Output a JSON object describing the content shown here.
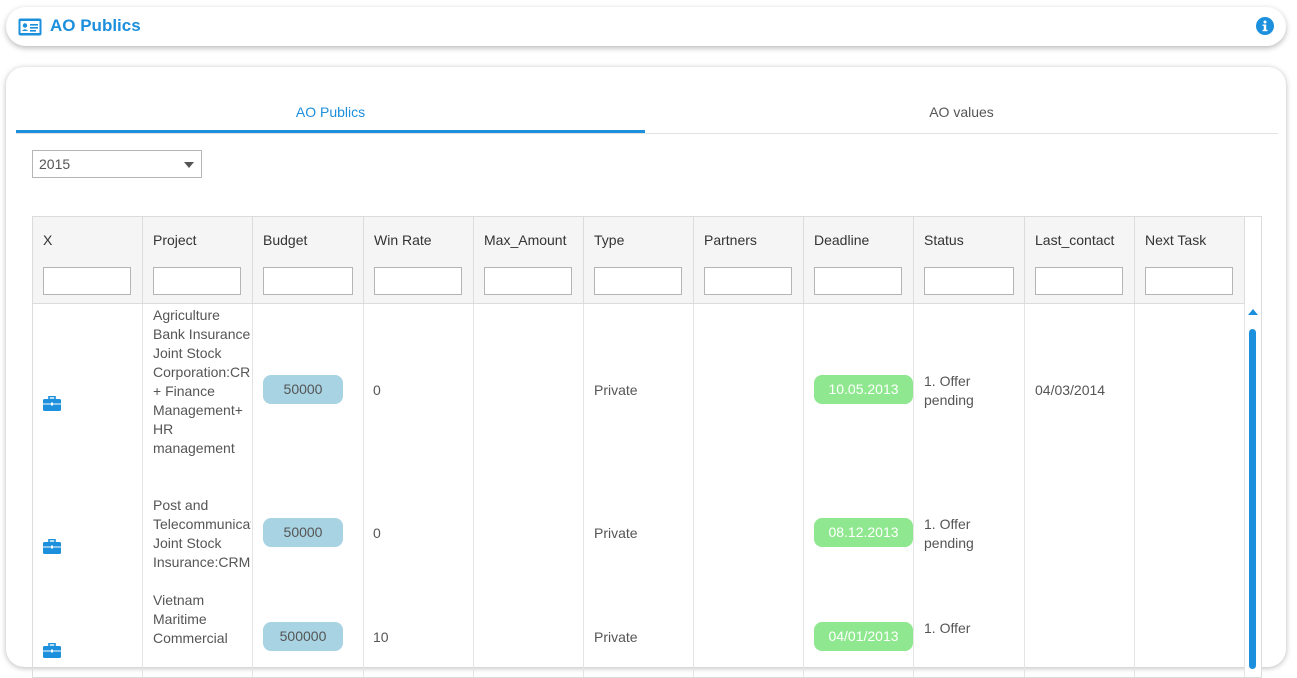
{
  "header": {
    "title": "AO Publics",
    "icon": "id-card-icon",
    "info_icon": "info-icon"
  },
  "tabs": [
    {
      "label": "AO Publics",
      "active": true
    },
    {
      "label": "AO values",
      "active": false
    }
  ],
  "year_select": {
    "value": "2015"
  },
  "table": {
    "columns": [
      "X",
      "Project",
      "Budget",
      "Win Rate",
      "Max_Amount",
      "Type",
      "Partners",
      "Deadline",
      "Status",
      "Last_contact",
      "Next Task"
    ],
    "rows": [
      {
        "icon": "briefcase-icon",
        "project": "Agriculture Bank Insurance Joint Stock Corporation:CRM + Finance Management+ HR management",
        "budget": "50000",
        "win_rate": "0",
        "max_amount": "",
        "type": "Private",
        "partners": "",
        "deadline": "10.05.2013",
        "status": "1. Offer pending",
        "last_contact": "04/03/2014",
        "next_task": ""
      },
      {
        "icon": "briefcase-icon",
        "project": "Post and Telecommunication Joint Stock Insurance:CRM",
        "budget": "50000",
        "win_rate": "0",
        "max_amount": "",
        "type": "Private",
        "partners": "",
        "deadline": "08.12.2013",
        "status": "1. Offer pending",
        "last_contact": "",
        "next_task": ""
      },
      {
        "icon": "briefcase-icon",
        "project": "Vietnam Maritime Commercial",
        "budget": "500000",
        "win_rate": "10",
        "max_amount": "",
        "type": "Private",
        "partners": "",
        "deadline": "04/01/2013",
        "status": "1. Offer",
        "last_contact": "",
        "next_task": ""
      }
    ]
  },
  "colors": {
    "accent": "#1c8fdd",
    "budget_pill": "#a8d3e3",
    "deadline_pill": "#8fe88f"
  }
}
